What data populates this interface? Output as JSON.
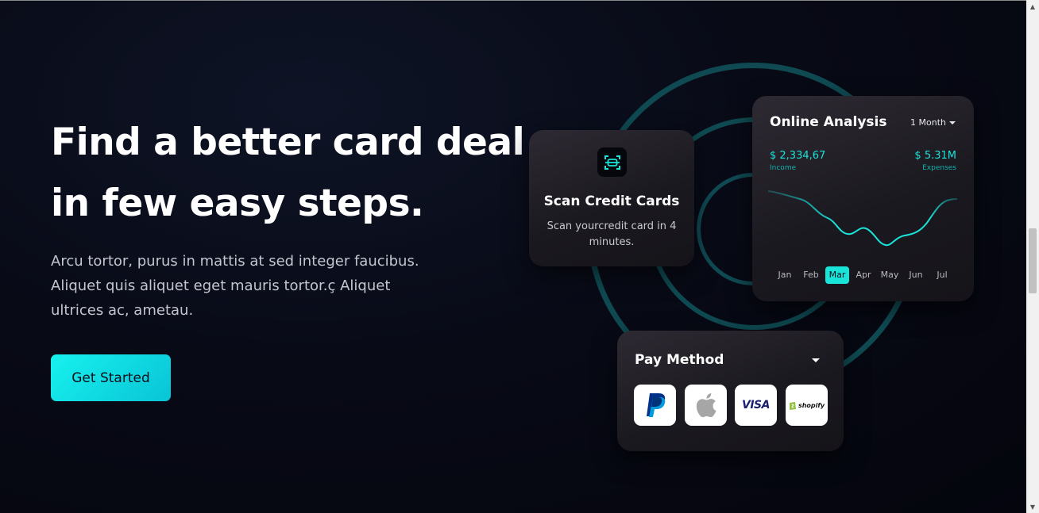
{
  "hero": {
    "title_line1": "Find a better card deal",
    "title_line2": "in few easy steps.",
    "description": "Arcu tortor, purus in mattis at sed integer faucibus. Aliquet quis aliquet eget mauris tortor.ç Aliquet ultrices ac, ametau.",
    "cta_label": "Get Started"
  },
  "scan_card": {
    "title": "Scan Credit Cards",
    "description": "Scan yourcredit card in 4 minutes.",
    "icon": "scan-icon"
  },
  "analysis_card": {
    "title": "Online Analysis",
    "period": "1 Month",
    "income_value": "$ 2,334,67",
    "income_label": "Income",
    "expenses_value": "$ 5.31M",
    "expenses_label": "Expenses",
    "months": [
      "Jan",
      "Feb",
      "Mar",
      "Apr",
      "May",
      "Jun",
      "Jul"
    ],
    "active_month": "Mar"
  },
  "pay_card": {
    "title": "Pay Method",
    "methods": [
      "paypal",
      "apple",
      "VISA",
      "shopify"
    ]
  },
  "colors": {
    "accent": "#19e4d9",
    "background": "#05060f",
    "card": "#1d1b21"
  }
}
